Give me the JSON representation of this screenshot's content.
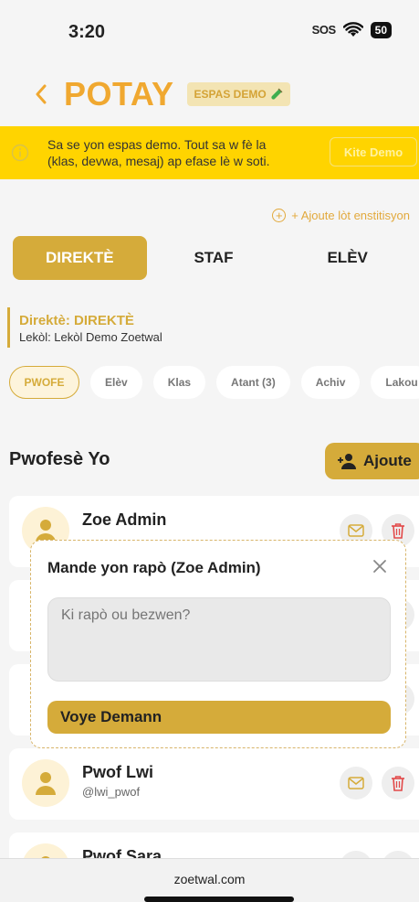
{
  "status_bar": {
    "time": "3:20",
    "sos": "SOS",
    "battery": "50"
  },
  "header": {
    "title": "POTAY",
    "demo_badge": "ESPAS DEMO"
  },
  "demo_banner": {
    "text": "Sa se yon espas demo. Tout sa w fè la (klas, devwa, mesaj) ap efase lè w soti.",
    "quit_label": "Kite Demo"
  },
  "add_institution_label": "+ Ajoute lòt enstitisyon",
  "role_tabs": [
    {
      "label": "DIREKTÈ",
      "active": true
    },
    {
      "label": "STAF",
      "active": false
    },
    {
      "label": "ELÈV",
      "active": false
    }
  ],
  "school": {
    "director": "Direktè: DIREKTÈ",
    "school": "Lekòl: Lekòl Demo Zoetwal"
  },
  "section_chips": [
    {
      "label": "PWOFE",
      "active": true
    },
    {
      "label": "Elèv",
      "active": false
    },
    {
      "label": "Klas",
      "active": false
    },
    {
      "label": "Atant (3)",
      "active": false
    },
    {
      "label": "Achiv",
      "active": false
    },
    {
      "label": "Lakou",
      "active": false
    }
  ],
  "section": {
    "title": "Pwofesè Yo",
    "add_label": "Ajoute"
  },
  "teachers": [
    {
      "name": "Zoe Admin",
      "handle": ""
    },
    {
      "name": "Pwof Lwi",
      "handle": "@lwi_pwof"
    },
    {
      "name": "Pwof Sara",
      "handle": ""
    }
  ],
  "modal": {
    "title": "Mande yon rapò (Zoe Admin)",
    "placeholder": "Ki rapò ou bezwen?",
    "submit_label": "Voye Demann"
  },
  "browser": {
    "url": "zoetwal.com"
  },
  "colors": {
    "accent": "#d5ab3a",
    "title_orange": "#f0a830",
    "banner_yellow": "#ffd400",
    "delete_red": "#e24848"
  },
  "icons": [
    "back-chevron-icon",
    "test-tube-icon",
    "info-icon",
    "circle-plus-icon",
    "add-person-icon",
    "person-icon",
    "mail-icon",
    "trash-icon",
    "close-icon",
    "wifi-icon"
  ]
}
